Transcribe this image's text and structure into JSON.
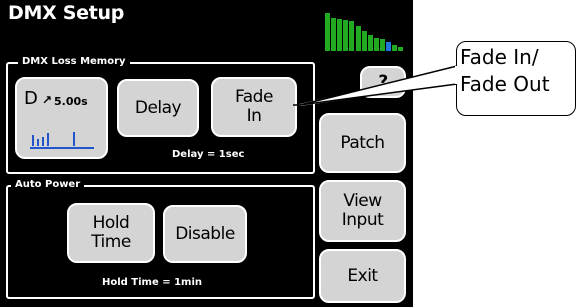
{
  "title": "DMX Setup",
  "signal_meter": {
    "color_active": "#22aa22",
    "color_highlight": "#2277dd",
    "levels": [
      1.0,
      0.87,
      0.84,
      0.82,
      0.79,
      0.66,
      0.53,
      0.42,
      0.34,
      0.32,
      0.24,
      0.16,
      0.11
    ]
  },
  "dmx_loss_memory": {
    "label": "DMX Loss Memory",
    "mode_button": {
      "letter": "D",
      "arrow": "↗",
      "time": "5.00s",
      "graph_icon": "level-graph-icon"
    },
    "delay_button": "Delay",
    "fade_button_line1": "Fade",
    "fade_button_line2": "In",
    "status": "Delay = 1sec"
  },
  "auto_power": {
    "label": "Auto Power",
    "hold_button_line1": "Hold",
    "hold_button_line2": "Time",
    "disable_button": "Disable",
    "status": "Hold Time = 1min"
  },
  "side_buttons": {
    "help": "?",
    "patch": "Patch",
    "view_line1": "View",
    "view_line2": "Input",
    "exit": "Exit"
  },
  "callout": {
    "line1": "Fade In/",
    "line2": "Fade Out"
  }
}
